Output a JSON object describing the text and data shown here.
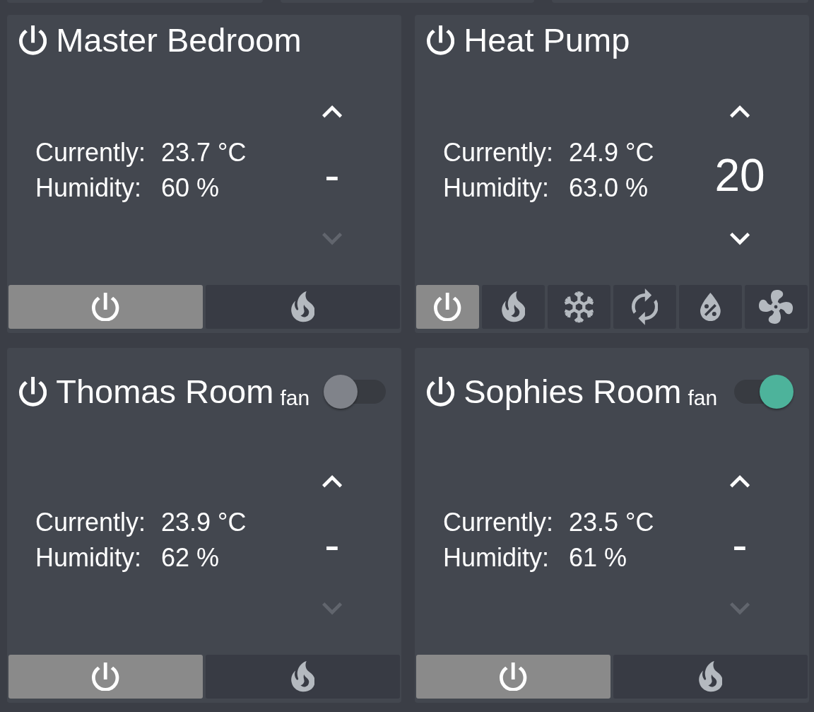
{
  "cards": [
    {
      "title": "Master Bedroom",
      "readings": [
        {
          "label": "Currently:",
          "value": "23.7 °C"
        },
        {
          "label": "Humidity:",
          "value": "60 %"
        }
      ],
      "setpoint": {
        "value": "-",
        "up_disabled": false,
        "down_disabled": true
      },
      "modes": [
        {
          "kind": "off",
          "selected": true
        },
        {
          "kind": "heat",
          "selected": false
        }
      ]
    },
    {
      "title": "Heat Pump",
      "readings": [
        {
          "label": "Currently:",
          "value": "24.9 °C"
        },
        {
          "label": "Humidity:",
          "value": "63.0 %"
        }
      ],
      "setpoint": {
        "value": "20",
        "up_disabled": false,
        "down_disabled": false
      },
      "modes": [
        {
          "kind": "off",
          "selected": true
        },
        {
          "kind": "heat",
          "selected": false
        },
        {
          "kind": "cool",
          "selected": false
        },
        {
          "kind": "auto",
          "selected": false
        },
        {
          "kind": "dry",
          "selected": false
        },
        {
          "kind": "fan_only",
          "selected": false
        }
      ]
    },
    {
      "title": "Thomas Room",
      "fan": {
        "label": "fan",
        "on": false
      },
      "readings": [
        {
          "label": "Currently:",
          "value": "23.9 °C"
        },
        {
          "label": "Humidity:",
          "value": "62 %"
        }
      ],
      "setpoint": {
        "value": "-",
        "up_disabled": false,
        "down_disabled": true
      },
      "modes": [
        {
          "kind": "off",
          "selected": true
        },
        {
          "kind": "heat",
          "selected": false
        }
      ]
    },
    {
      "title": "Sophies Room",
      "fan": {
        "label": "fan",
        "on": true
      },
      "readings": [
        {
          "label": "Currently:",
          "value": "23.5 °C"
        },
        {
          "label": "Humidity:",
          "value": "61 %"
        }
      ],
      "setpoint": {
        "value": "-",
        "up_disabled": false,
        "down_disabled": true
      },
      "modes": [
        {
          "kind": "off",
          "selected": true
        },
        {
          "kind": "heat",
          "selected": false
        }
      ]
    }
  ]
}
